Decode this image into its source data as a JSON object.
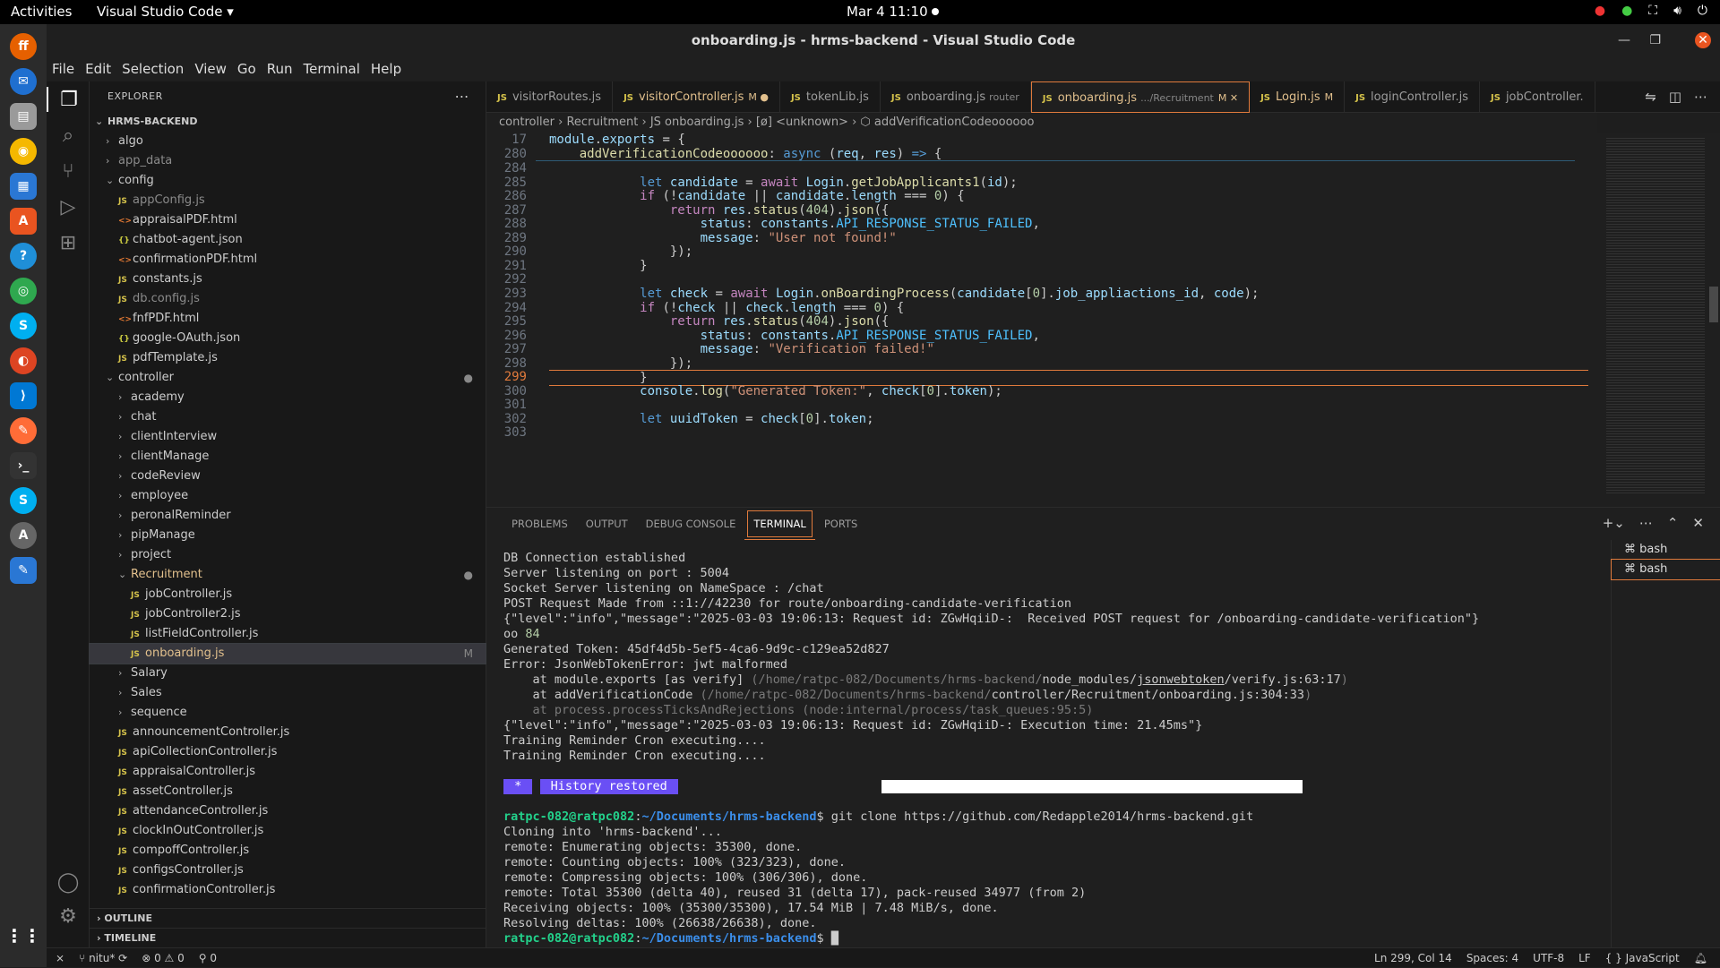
{
  "system": {
    "activities": "Activities",
    "app": "Visual Studio Code ▾",
    "clock": "Mar 4  11:10"
  },
  "window": {
    "title": "onboarding.js - hrms-backend - Visual Studio Code"
  },
  "menu": [
    "File",
    "Edit",
    "Selection",
    "View",
    "Go",
    "Run",
    "Terminal",
    "Help"
  ],
  "explorer": {
    "title": "EXPLORER",
    "project": "HRMS-BACKEND",
    "rows": [
      {
        "t": "algo",
        "d": 1,
        "k": "folder",
        "open": false
      },
      {
        "t": "app_data",
        "d": 1,
        "k": "folder",
        "open": false,
        "dim": true
      },
      {
        "t": "config",
        "d": 1,
        "k": "folder",
        "open": true
      },
      {
        "t": "appConfig.js",
        "d": 2,
        "k": "js",
        "dim": true
      },
      {
        "t": "appraisalPDF.html",
        "d": 2,
        "k": "html"
      },
      {
        "t": "chatbot-agent.json",
        "d": 2,
        "k": "json"
      },
      {
        "t": "confirmationPDF.html",
        "d": 2,
        "k": "html"
      },
      {
        "t": "constants.js",
        "d": 2,
        "k": "js"
      },
      {
        "t": "db.config.js",
        "d": 2,
        "k": "js",
        "dim": true
      },
      {
        "t": "fnfPDF.html",
        "d": 2,
        "k": "html"
      },
      {
        "t": "google-OAuth.json",
        "d": 2,
        "k": "json"
      },
      {
        "t": "pdfTemplate.js",
        "d": 2,
        "k": "js"
      },
      {
        "t": "controller",
        "d": 1,
        "k": "folder",
        "open": true,
        "mark": "●"
      },
      {
        "t": "academy",
        "d": 2,
        "k": "folder",
        "open": false
      },
      {
        "t": "chat",
        "d": 2,
        "k": "folder",
        "open": false
      },
      {
        "t": "clientInterview",
        "d": 2,
        "k": "folder",
        "open": false
      },
      {
        "t": "clientManage",
        "d": 2,
        "k": "folder",
        "open": false
      },
      {
        "t": "codeReview",
        "d": 2,
        "k": "folder",
        "open": false
      },
      {
        "t": "employee",
        "d": 2,
        "k": "folder",
        "open": false
      },
      {
        "t": "peronalReminder",
        "d": 2,
        "k": "folder",
        "open": false
      },
      {
        "t": "pipManage",
        "d": 2,
        "k": "folder",
        "open": false
      },
      {
        "t": "project",
        "d": 2,
        "k": "folder",
        "open": false
      },
      {
        "t": "Recruitment",
        "d": 2,
        "k": "folder",
        "open": true,
        "mark": "●",
        "orange": true
      },
      {
        "t": "jobController.js",
        "d": 3,
        "k": "js"
      },
      {
        "t": "jobController2.js",
        "d": 3,
        "k": "js"
      },
      {
        "t": "listFieldController.js",
        "d": 3,
        "k": "js"
      },
      {
        "t": "onboarding.js",
        "d": 3,
        "k": "js",
        "sel": true,
        "mark": "M",
        "orange": true
      },
      {
        "t": "Salary",
        "d": 2,
        "k": "folder",
        "open": false
      },
      {
        "t": "Sales",
        "d": 2,
        "k": "folder",
        "open": false
      },
      {
        "t": "sequence",
        "d": 2,
        "k": "folder",
        "open": false
      },
      {
        "t": "announcementController.js",
        "d": 2,
        "k": "js"
      },
      {
        "t": "apiCollectionController.js",
        "d": 2,
        "k": "js"
      },
      {
        "t": "appraisalController.js",
        "d": 2,
        "k": "js"
      },
      {
        "t": "assetController.js",
        "d": 2,
        "k": "js"
      },
      {
        "t": "attendanceController.js",
        "d": 2,
        "k": "js"
      },
      {
        "t": "clockInOutController.js",
        "d": 2,
        "k": "js"
      },
      {
        "t": "compoffController.js",
        "d": 2,
        "k": "js"
      },
      {
        "t": "configsController.js",
        "d": 2,
        "k": "js"
      },
      {
        "t": "confirmationController.js",
        "d": 2,
        "k": "js"
      }
    ],
    "outline": "OUTLINE",
    "timeline": "TIMELINE"
  },
  "tabs": [
    {
      "name": "visitorRoutes.js",
      "sub": "",
      "mod": ""
    },
    {
      "name": "visitorController.js",
      "sub": "",
      "mod": "M ●"
    },
    {
      "name": "tokenLib.js",
      "sub": "",
      "mod": ""
    },
    {
      "name": "onboarding.js",
      "sub": "router",
      "mod": ""
    },
    {
      "name": "onboarding.js",
      "sub": ".../Recruitment",
      "mod": "M ✕",
      "active": true
    },
    {
      "name": "Login.js",
      "sub": "",
      "mod": "M"
    },
    {
      "name": "loginController.js",
      "sub": "",
      "mod": ""
    },
    {
      "name": "jobController.",
      "sub": "",
      "mod": ""
    }
  ],
  "breadcrumb": "controller › Recruitment › JS onboarding.js › [ø] <unknown> › ⬡ addVerificationCodeoooooo",
  "code": [
    {
      "n": "17",
      "h": "<span class='var'>module</span>.<span class='var'>exports</span> = {"
    },
    {
      "n": "280",
      "h": "    <span class='fn'>addVerificationCodeoooooo</span>: <span class='blue'>async</span> (<span class='var'>req</span>, <span class='var'>res</span>) <span class='blue'>=></span> {"
    },
    {
      "n": "284",
      "h": ""
    },
    {
      "n": "285",
      "h": "            <span class='blue'>let</span> <span class='var'>candidate</span> = <span class='kw'>await</span> <span class='var'>Login</span>.<span class='fn'>getJobApplicants1</span>(<span class='var'>id</span>);"
    },
    {
      "n": "286",
      "h": "            <span class='kw'>if</span> (!<span class='var'>candidate</span> || <span class='var'>candidate</span>.<span class='var'>length</span> === <span class='num'>0</span>) {"
    },
    {
      "n": "287",
      "h": "                <span class='kw'>return</span> <span class='var'>res</span>.<span class='fn'>status</span>(<span class='num'>404</span>).<span class='fn'>json</span>({"
    },
    {
      "n": "288",
      "h": "                    <span class='var'>status</span>: <span class='var'>constants</span>.<span class='const'>API_RESPONSE_STATUS_FAILED</span>,"
    },
    {
      "n": "289",
      "h": "                    <span class='var'>message</span>: <span class='str'>\"User not found!\"</span>"
    },
    {
      "n": "290",
      "h": "                });"
    },
    {
      "n": "291",
      "h": "            }"
    },
    {
      "n": "292",
      "h": ""
    },
    {
      "n": "293",
      "h": "            <span class='blue'>let</span> <span class='var'>check</span> = <span class='kw'>await</span> <span class='var'>Login</span>.<span class='fn'>onBoardingProcess</span>(<span class='var'>candidate</span>[<span class='num'>0</span>].<span class='var'>job_appliactions_id</span>, <span class='var'>code</span>);"
    },
    {
      "n": "294",
      "h": "            <span class='kw'>if</span> (!<span class='var'>check</span> || <span class='var'>check</span>.<span class='var'>length</span> === <span class='num'>0</span>) {"
    },
    {
      "n": "295",
      "h": "                <span class='kw'>return</span> <span class='var'>res</span>.<span class='fn'>status</span>(<span class='num'>404</span>).<span class='fn'>json</span>({"
    },
    {
      "n": "296",
      "h": "                    <span class='var'>status</span>: <span class='var'>constants</span>.<span class='const'>API_RESPONSE_STATUS_FAILED</span>,"
    },
    {
      "n": "297",
      "h": "                    <span class='var'>message</span>: <span class='str'>\"Verification failed!\"</span>"
    },
    {
      "n": "298",
      "h": "                });"
    },
    {
      "n": "299",
      "h": "            }"
    },
    {
      "n": "300",
      "h": "            <span class='var'>console</span>.<span class='fn'>log</span>(<span class='str'>\"Generated Token:\"</span>, <span class='var'>check</span>[<span class='num'>0</span>].<span class='var'>token</span>);"
    },
    {
      "n": "301",
      "h": ""
    },
    {
      "n": "302",
      "h": "            <span class='blue'>let</span> <span class='var'>uuidToken</span> = <span class='var'>check</span>[<span class='num'>0</span>].<span class='var'>token</span>;"
    },
    {
      "n": "303",
      "h": ""
    }
  ],
  "panel": {
    "tabs": [
      "PROBLEMS",
      "OUTPUT",
      "DEBUG CONSOLE",
      "TERMINAL",
      "PORTS"
    ],
    "terminals": [
      "bash",
      "bash"
    ]
  },
  "terminal": [
    "DB Connection established",
    "Server listening on port : 5004",
    "Socket Server listening on NameSpace : /chat",
    "POST Request Made from ::1://42230 for route/onboarding-candidate-verification",
    "{\"level\":\"info\",\"message\":\"2025-03-03 19:06:13: Request id: ZGwHqiiD-:  Received POST request for /onboarding-candidate-verification\"}",
    "oo <span class='num'>84</span>",
    "Generated Token: 45df4d5b-5ef5-4ca6-9d9c-c129ea52d827",
    "Error: JsonWebTokenError: jwt malformed",
    "    at module.exports [as verify] <span class='dg'>(/home/ratpc-082/Documents/hrms-backend/</span>node_modules/<span class='ul'>jsonwebtoken</span>/verify.js:63:17<span class='dg'>)</span>",
    "    at addVerificationCode <span class='dg'>(/home/ratpc-082/Documents/hrms-backend/</span>controller/Recruitment/onboarding.js:304:33<span class='dg'>)</span>",
    "<span class='dg'>    at process.processTicksAndRejections (node:internal/process/task_queues:95:5)</span>",
    "{\"level\":\"info\",\"message\":\"2025-03-03 19:06:13: Request id: ZGwHqiiD-: Execution time: 21.45ms\"}",
    "Training Reminder Cron executing....",
    "Training Reminder Cron executing....",
    "",
    "<span class='hist'> * </span> <span class='hist'> History restored </span>                            <span class='bar'></span>",
    "",
    "<span class='g'>ratpc-082@ratpc082</span>:<span class='b'>~/Documents/hrms-backend</span>$ git clone https://github.com/Redapple2014/hrms-backend.git",
    "Cloning into 'hrms-backend'...",
    "remote: Enumerating objects: 35300, done.",
    "remote: Counting objects: 100% (323/323), done.",
    "remote: Compressing objects: 100% (306/306), done.",
    "remote: Total 35300 (delta 40), reused 31 (delta 17), pack-reused 34977 (from 2)",
    "Receiving objects: 100% (35300/35300), 17.54 MiB | 7.48 MiB/s, done.",
    "Resolving deltas: 100% (26638/26638), done.",
    "<span class='g'>ratpc-082@ratpc082</span>:<span class='b'>~/Documents/hrms-backend</span>$ █"
  ],
  "status": {
    "branch": "nitu*",
    "problems": "⊗ 0 ⚠ 0",
    "ports": "⚲ 0",
    "pos": "Ln 299, Col 14",
    "spaces": "Spaces: 4",
    "enc": "UTF-8",
    "eol": "LF",
    "lang": "{ } JavaScript"
  }
}
